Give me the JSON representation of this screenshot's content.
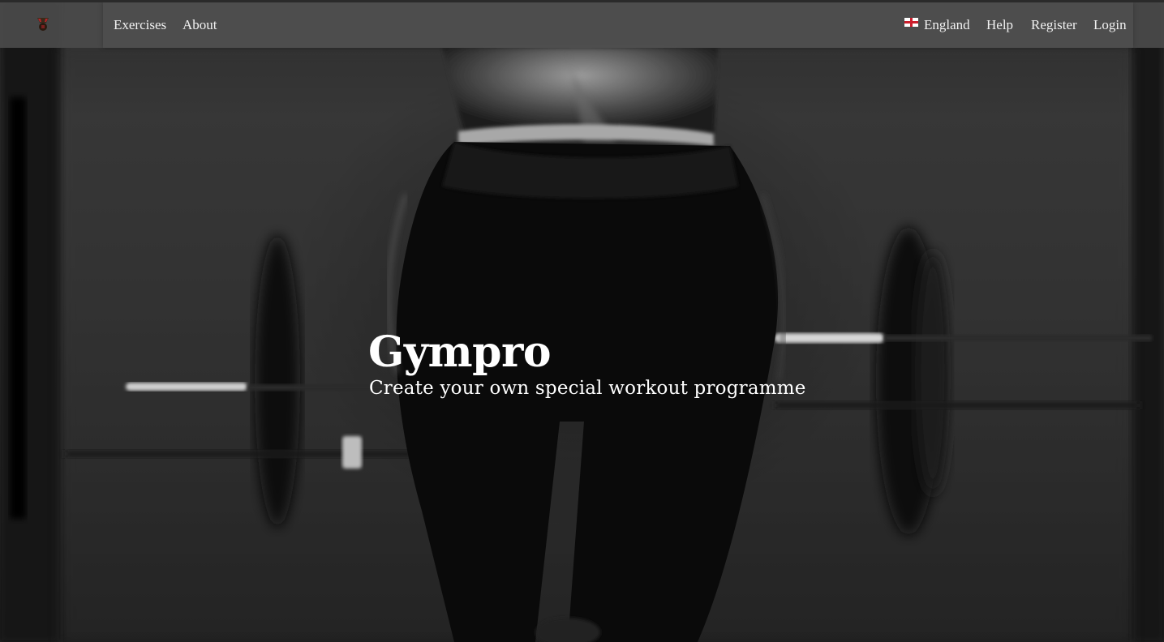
{
  "nav": {
    "brand_icon": "kettlebell-logo-icon",
    "left_links": [
      {
        "label": "Exercises"
      },
      {
        "label": "About"
      }
    ],
    "country": {
      "label": "England",
      "flag_icon": "england-flag-icon"
    },
    "right_links": [
      {
        "label": "Help"
      },
      {
        "label": "Register"
      },
      {
        "label": "Login"
      }
    ]
  },
  "hero": {
    "title": "Gympro",
    "subtitle": "Create your own special workout programme",
    "background_image": "black-and-white gym photo"
  },
  "colors": {
    "navbar_bg": "#4a4a4a",
    "nav_text": "#f2f2f2",
    "hero_text": "#ffffff",
    "flag_red": "#cc1f2d",
    "logo_red": "#b0262b"
  }
}
